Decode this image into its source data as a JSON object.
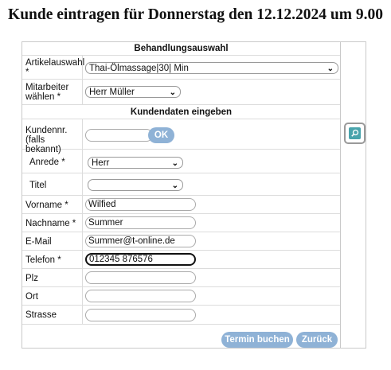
{
  "page_title": "Kunde eintragen für Donnerstag den 12.12.2024 um 9.00",
  "section_treatment": "Behandlungsauswahl",
  "section_customer": "Kundendaten eingeben",
  "labels": {
    "article": "Artikelauswahl *",
    "employee": "Mitarbeiter wählen *",
    "customer_no": "Kundennr. (falls bekannt)",
    "salutation": "Anrede *",
    "title": "Titel",
    "firstname": "Vorname *",
    "lastname": "Nachname *",
    "email": "E-Mail",
    "phone": "Telefon *",
    "zip": "Plz",
    "city": "Ort",
    "street": "Strasse"
  },
  "values": {
    "article": "Thai-Ölmassage|30| Min",
    "employee": "Herr Müller",
    "customer_no": "",
    "salutation": "Herr",
    "title": "",
    "firstname": "Wilfied",
    "lastname": "Summer",
    "email": "Summer@t-online.de",
    "phone": "012345 876576",
    "zip": "",
    "city": "",
    "street": ""
  },
  "buttons": {
    "ok": "OK",
    "book": "Termin buchen",
    "back": "Zurück"
  },
  "icons": {
    "dropdown": "chevron-down-icon",
    "search": "search-icon"
  },
  "colors": {
    "button": "#8fb2d6",
    "search_icon": "#49a4ac"
  }
}
